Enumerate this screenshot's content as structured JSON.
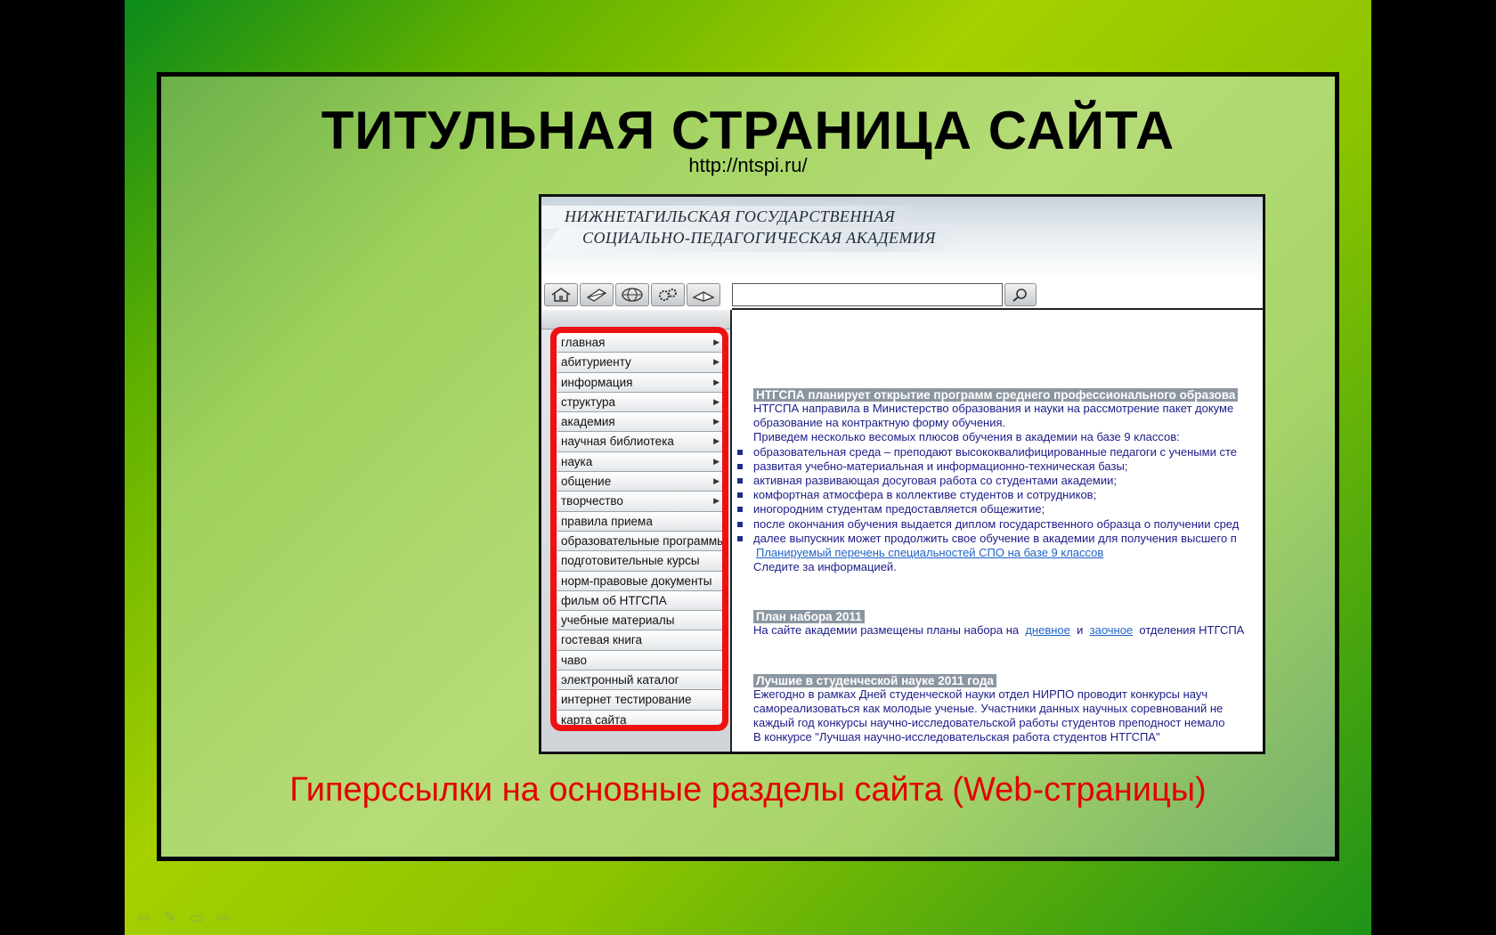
{
  "slide": {
    "title": "ТИТУЛЬНАЯ СТРАНИЦА САЙТА",
    "url": "http://ntspi.ru/",
    "caption": "Гиперссылки на основные разделы сайта (Web-страницы)"
  },
  "site": {
    "header_line1": "НИЖНЕТАГИЛЬСКАЯ ГОСУДАРСТВЕННАЯ",
    "header_line2": "СОЦИАЛЬНО-ПЕДАГОГИЧЕСКАЯ АКАДЕМИЯ",
    "search_value": "",
    "toolbar_icons": [
      "home-icon",
      "mail-icon",
      "globe-icon",
      "gears-icon",
      "book-icon"
    ],
    "menu": [
      {
        "label": "главная",
        "submenu": true
      },
      {
        "label": "абитуриенту",
        "submenu": true
      },
      {
        "label": "информация",
        "submenu": true
      },
      {
        "label": "структура",
        "submenu": true
      },
      {
        "label": "академия",
        "submenu": true
      },
      {
        "label": "научная библиотека",
        "submenu": true
      },
      {
        "label": "наука",
        "submenu": true
      },
      {
        "label": "общение",
        "submenu": true
      },
      {
        "label": "творчество",
        "submenu": true
      },
      {
        "label": "правила приема",
        "submenu": false
      },
      {
        "label": "образовательные программы",
        "submenu": false
      },
      {
        "label": "подготовительные курсы",
        "submenu": false
      },
      {
        "label": "норм-правовые документы",
        "submenu": false
      },
      {
        "label": "фильм об НТГСПА",
        "submenu": false
      },
      {
        "label": "учебные материалы",
        "submenu": false
      },
      {
        "label": "гостевая книга",
        "submenu": false
      },
      {
        "label": "чаво",
        "submenu": false
      },
      {
        "label": "электронный каталог",
        "submenu": false
      },
      {
        "label": "интернет тестирование",
        "submenu": false
      },
      {
        "label": "карта сайта",
        "submenu": false
      }
    ],
    "news1": {
      "title": "НТГСПА планирует открытие программ среднего профессионального образова",
      "p1": "НТГСПА направила в Министерство образования и науки на рассмотрение пакет докуме",
      "p2": "образование на контрактную форму обучения.",
      "p3": "Приведем несколько весомых плюсов обучения в академии на базе 9 классов:",
      "bullets": [
        "образовательная среда – преподают высококвалифицированные педагоги с учеными сте",
        "развитая учебно-материальная и информационно-техническая базы;",
        "активная развивающая досуговая работа со студентами академии;",
        "комфортная атмосфера в коллективе студентов и сотрудников;",
        "иногородним студентам предоставляется общежитие;",
        "после окончания обучения выдается диплом государственного образца о получении сред",
        "далее выпускник может продолжить свое обучение в академии для получения высшего п"
      ],
      "link": "Планируемый перечень специальностей СПО на базе 9 классов",
      "outro": "Следите за информацией."
    },
    "news2": {
      "title": "План набора 2011",
      "text_before": "На сайте академии размещены планы набора на",
      "link1": "дневное",
      "and": "и",
      "link2": "заочное",
      "text_after": "отделения НТГСПА"
    },
    "news3": {
      "title": "Лучшие в студенческой науке 2011 года",
      "lines": [
        "Ежегодно в рамках Дней студенческой науки отдел НИРПО проводит конкурсы науч",
        "самореализоваться как молодые ученые. Участники данных научных соревнований не",
        "каждый год конкурсы научно-исследовательской работы студентов преподност немало",
        "В конкурсе \"Лучшая научно-исследовательская работа студентов НТГСПА\""
      ]
    }
  },
  "nav": {
    "prev": "⇦",
    "pen": "✎",
    "menu": "▭",
    "next": "⇨"
  }
}
